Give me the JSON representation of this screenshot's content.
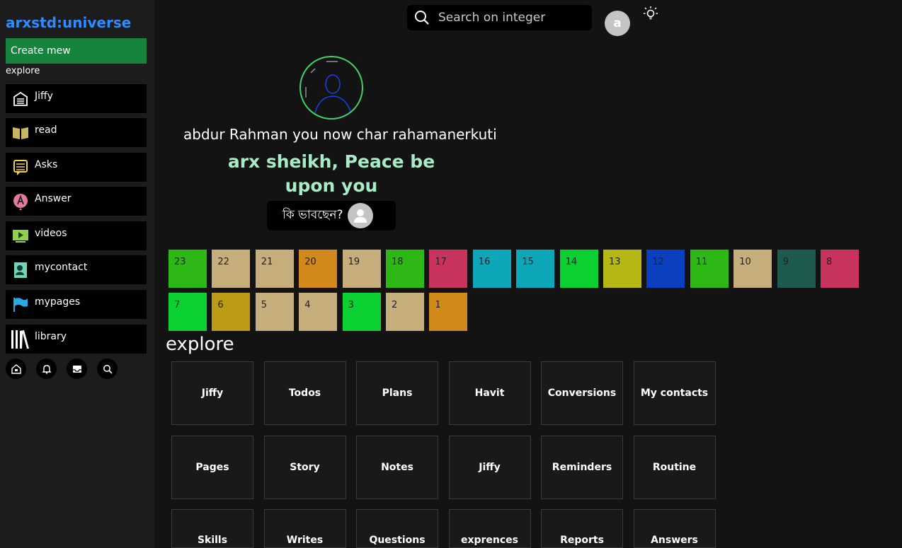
{
  "sidebar": {
    "brand": "arxstd:universe",
    "create_label": "Create mew",
    "explore_label": "explore",
    "items": [
      {
        "label": "Jiffy",
        "icon": "building-icon"
      },
      {
        "label": "read",
        "icon": "book-icon"
      },
      {
        "label": "Asks",
        "icon": "note-icon"
      },
      {
        "label": "Answer",
        "icon": "answer-badge-icon"
      },
      {
        "label": "videos",
        "icon": "video-play-icon"
      },
      {
        "label": "mycontact",
        "icon": "contact-card-icon"
      },
      {
        "label": "mypages",
        "icon": "flag-icon"
      },
      {
        "label": "library",
        "icon": "library-icon"
      }
    ],
    "round_buttons": [
      "home-icon",
      "bell-icon",
      "inbox-icon",
      "search-icon"
    ]
  },
  "header": {
    "search_placeholder": "Search on integer",
    "avatar_letter": "a"
  },
  "greeting": {
    "name_line": "abdur Rahman you now char rahamanerkuti",
    "peace_line": "arx sheikh, Peace be upon you",
    "post_prompt": "কি ভাবছেন?"
  },
  "days": [
    {
      "n": "23",
      "color": "#2eb816"
    },
    {
      "n": "22",
      "color": "#c6ad7c"
    },
    {
      "n": "21",
      "color": "#c6ad7c"
    },
    {
      "n": "20",
      "color": "#d1891c"
    },
    {
      "n": "19",
      "color": "#c6ad7c"
    },
    {
      "n": "18",
      "color": "#2eb816"
    },
    {
      "n": "17",
      "color": "#c9345e"
    },
    {
      "n": "16",
      "color": "#0ea6b9"
    },
    {
      "n": "15",
      "color": "#0ea6b9"
    },
    {
      "n": "14",
      "color": "#0ad032"
    },
    {
      "n": "13",
      "color": "#b5b814"
    },
    {
      "n": "12",
      "color": "#0a3fc0"
    },
    {
      "n": "11",
      "color": "#2eb816"
    },
    {
      "n": "10",
      "color": "#c6ad7c"
    },
    {
      "n": "9",
      "color": "#1f5a51"
    },
    {
      "n": "8",
      "color": "#c9345e"
    },
    {
      "n": "7",
      "color": "#0ad032"
    },
    {
      "n": "6",
      "color": "#bb9c14"
    },
    {
      "n": "5",
      "color": "#c6ad7c"
    },
    {
      "n": "4",
      "color": "#c6ad7c"
    },
    {
      "n": "3",
      "color": "#0ad032"
    },
    {
      "n": "2",
      "color": "#c6ad7c"
    },
    {
      "n": "1",
      "color": "#d1891c"
    }
  ],
  "explore": {
    "heading": "explore",
    "tiles": [
      "Jiffy",
      "Todos",
      "Plans",
      "Havit",
      "Conversions",
      "My contacts",
      "Pages",
      "Story",
      "Notes",
      "Jiffy",
      "Reminders",
      "Routine",
      "Skills",
      "Writes",
      "Questions",
      "exprences",
      "Reports",
      "Answers"
    ]
  }
}
